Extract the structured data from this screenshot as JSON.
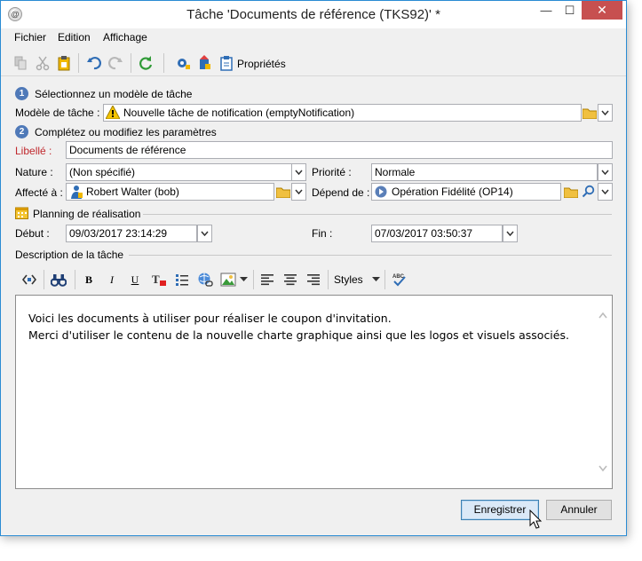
{
  "window": {
    "title": "Tâche 'Documents de référence (TKS92)' *",
    "app_icon": "@",
    "controls": {
      "minimize": "—",
      "maximize": "☐",
      "close": "✕"
    }
  },
  "menu": {
    "items": [
      "Fichier",
      "Edition",
      "Affichage"
    ]
  },
  "toolbar": {
    "properties_label": "Propriétés",
    "icons": [
      "copy-icon",
      "cut-icon",
      "paste-icon",
      "undo-icon",
      "redo-icon",
      "refresh-icon",
      "settings-gear-icon",
      "export-icon",
      "properties-icon"
    ]
  },
  "form": {
    "step1": {
      "number": "1",
      "label": "Sélectionnez un modèle de tâche"
    },
    "template": {
      "label": "Modèle de tâche :",
      "value": "Nouvelle tâche de notification (emptyNotification)"
    },
    "step2": {
      "number": "2",
      "label": "Complétez ou modifiez les paramètres"
    },
    "libelle": {
      "label": "Libellé :",
      "value": "Documents de référence"
    },
    "nature": {
      "label": "Nature :",
      "value": "(Non spécifié)"
    },
    "priority": {
      "label": "Priorité :",
      "value": "Normale"
    },
    "assigned": {
      "label": "Affecté à :",
      "value": "Robert Walter (bob)"
    },
    "depends": {
      "label": "Dépend de :",
      "value": "Opération Fidélité (OP14)"
    },
    "planning": {
      "label": "Planning de réalisation"
    },
    "start": {
      "label": "Début :",
      "value": "09/03/2017 23:14:29"
    },
    "end": {
      "label": "Fin :",
      "value": "07/03/2017 03:50:37"
    },
    "description": {
      "label": "Description de la tâche"
    }
  },
  "editor": {
    "toolbar": {
      "bold": "B",
      "italic": "I",
      "underline": "U",
      "styles": "Styles"
    },
    "lines": [
      "Voici les documents à utiliser pour réaliser le coupon d'invitation.",
      "Merci d'utiliser le contenu de la nouvelle charte graphique ainsi que les logos et visuels associés."
    ]
  },
  "buttons": {
    "save": "Enregistrer",
    "cancel": "Annuler"
  },
  "colors": {
    "accent": "#2a8bd3",
    "close_red": "#c75050",
    "required_label": "#c0282d",
    "warning_yellow": "#f5c400"
  }
}
